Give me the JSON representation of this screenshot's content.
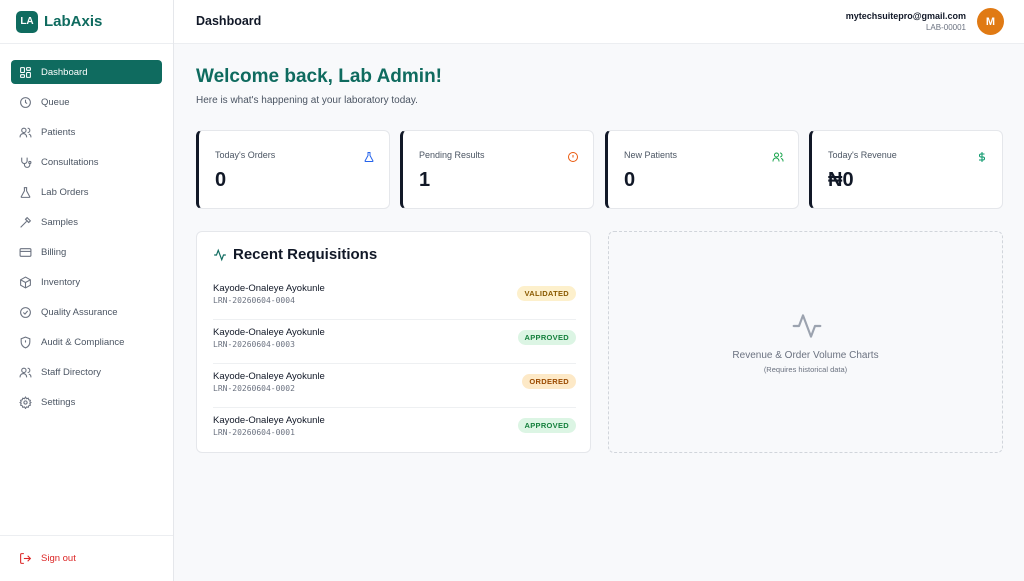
{
  "brand": {
    "logo": "LA",
    "name": "LabAxis"
  },
  "sidebar": {
    "items": [
      {
        "label": "Dashboard",
        "icon": "grid-icon",
        "active": true
      },
      {
        "label": "Queue",
        "icon": "clock-icon"
      },
      {
        "label": "Patients",
        "icon": "users-icon"
      },
      {
        "label": "Consultations",
        "icon": "stethoscope-icon"
      },
      {
        "label": "Lab Orders",
        "icon": "flask-icon"
      },
      {
        "label": "Samples",
        "icon": "pipette-icon"
      },
      {
        "label": "Billing",
        "icon": "credit-card-icon"
      },
      {
        "label": "Inventory",
        "icon": "box-icon"
      },
      {
        "label": "Quality Assurance",
        "icon": "check-circle-icon"
      },
      {
        "label": "Audit & Compliance",
        "icon": "shield-icon"
      },
      {
        "label": "Staff Directory",
        "icon": "users-icon"
      },
      {
        "label": "Settings",
        "icon": "gear-icon"
      }
    ],
    "signout": "Sign out"
  },
  "header": {
    "title": "Dashboard",
    "email": "mytechsuitepro@gmail.com",
    "lab_id": "LAB-00001",
    "avatar": "M"
  },
  "main": {
    "welcome": "Welcome back, Lab Admin!",
    "subtitle": "Here is what's happening at your laboratory today.",
    "stats": [
      {
        "label": "Today's Orders",
        "value": "0",
        "icon": "flask-icon",
        "color": "#2563eb"
      },
      {
        "label": "Pending Results",
        "value": "1",
        "icon": "alert-circle-icon",
        "color": "#ea580c"
      },
      {
        "label": "New Patients",
        "value": "0",
        "icon": "users-icon",
        "color": "#16a34a"
      },
      {
        "label": "Today's Revenue",
        "value": "₦0",
        "icon": "dollar-icon",
        "color": "#059669"
      }
    ],
    "requisitions": {
      "title": "Recent Requisitions",
      "items": [
        {
          "name": "Kayode-Onaleye Ayokunle",
          "id": "LRN-20260604-0004",
          "status": "VALIDATED"
        },
        {
          "name": "Kayode-Onaleye Ayokunle",
          "id": "LRN-20260604-0003",
          "status": "APPROVED"
        },
        {
          "name": "Kayode-Onaleye Ayokunle",
          "id": "LRN-20260604-0002",
          "status": "ORDERED"
        },
        {
          "name": "Kayode-Onaleye Ayokunle",
          "id": "LRN-20260604-0001",
          "status": "APPROVED"
        }
      ]
    },
    "chart_placeholder": {
      "title": "Revenue & Order Volume Charts",
      "subtitle": "(Requires historical data)"
    }
  }
}
